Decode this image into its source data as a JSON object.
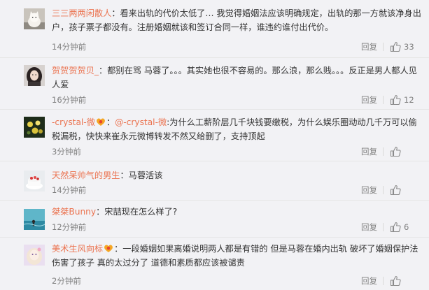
{
  "comments": [
    {
      "user": "三三两两闲散人",
      "badge": false,
      "text": "：看来出轨的代价太低了… 我觉得婚姻法应该明确规定，出轨的那一方就该净身出户，孩子票子都没有。注册婚姻就该和签订合同一样，谁违约谁付出代价。",
      "time": "14分钟前",
      "reply": "回复",
      "likes": "33",
      "avatar": "cat-avatar"
    },
    {
      "user": "贺贺贺贺贝_",
      "badge": false,
      "text": "：都别在骂 马蓉了。。。其实她也很不容易的。那么浪，那么贱。。。反正是男人都人见人爱",
      "time": "16分钟前",
      "reply": "回复",
      "likes": "12",
      "avatar": "girl-portrait-avatar"
    },
    {
      "user": "-crystal-微",
      "badge": true,
      "mention": "@-crystal-微",
      "text": ":为什么工薪阶层几千块钱要缴税，为什么娱乐圈动动几千万可以偷税漏税，快快来崔永元微博转发不然又给删了，支持顶起",
      "time": "3分钟前",
      "reply": "回复",
      "likes": "",
      "avatar": "flowers-avatar"
    },
    {
      "user": "天然呆帅气的男生",
      "badge": false,
      "text": "：马蓉活该",
      "time": "14分钟前",
      "reply": "回复",
      "likes": "",
      "avatar": "cake-avatar"
    },
    {
      "user": "桀桀Bunny",
      "badge": false,
      "text": "：宋喆现在怎么样了?",
      "time": "12分钟前",
      "reply": "回复",
      "likes": "6",
      "avatar": "ocean-avatar"
    },
    {
      "user": "美术生风向标",
      "badge": true,
      "text": "：一段婚姻如果离婚说明两人都是有错的 但是马蓉在婚内出轨 破坏了婚姻保护法 伤害了孩子 真的太过分了 道德和素质都应该被谴责",
      "time": "2分钟前",
      "reply": "回复",
      "likes": "",
      "avatar": "anime-girl-avatar"
    }
  ]
}
